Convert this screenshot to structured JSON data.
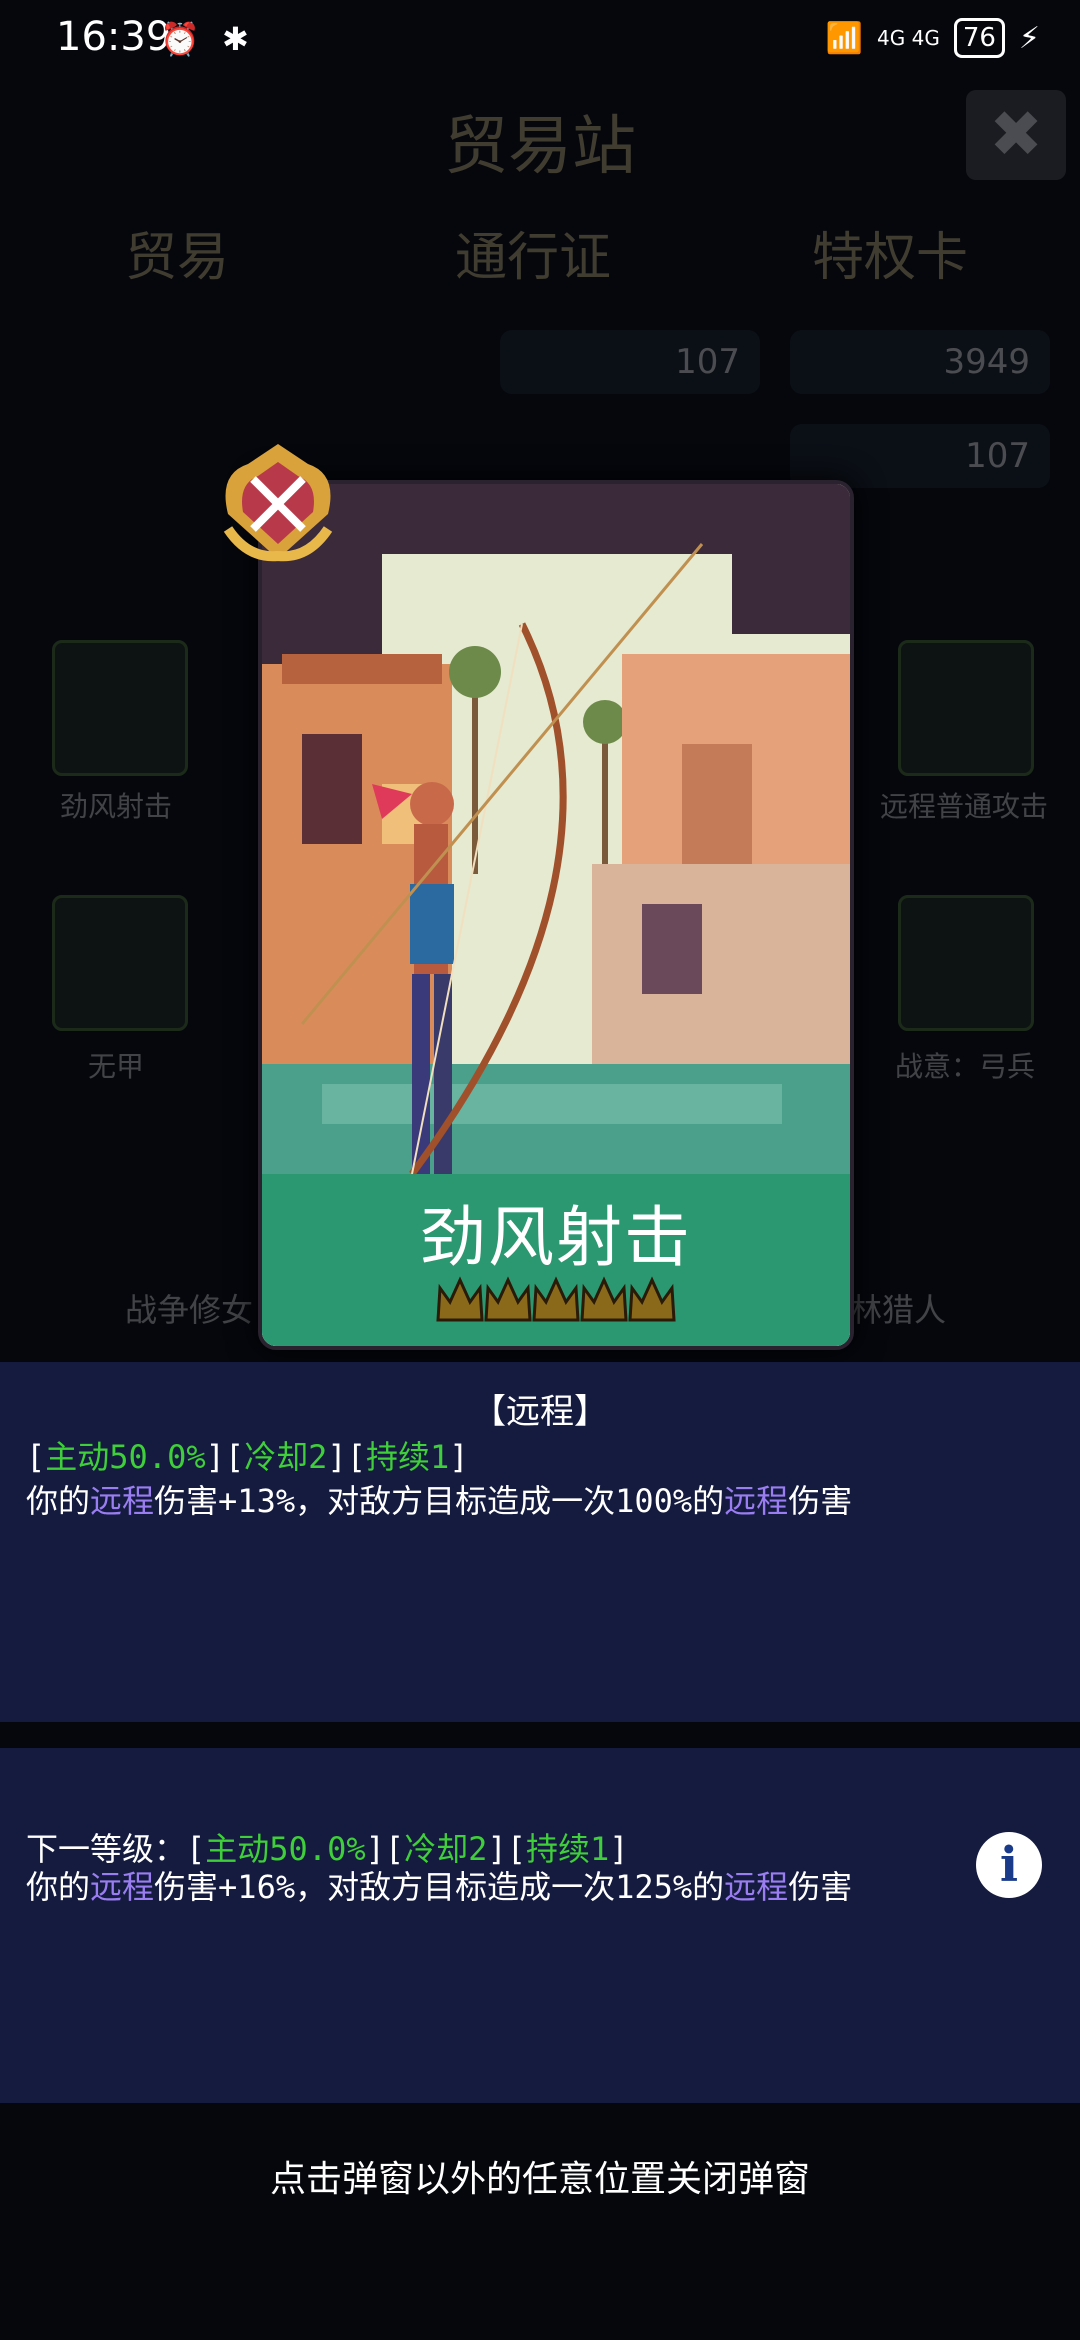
{
  "status_bar": {
    "time": "16:39",
    "left_icons": "⏰ ✱",
    "network": "4G 4G",
    "battery": "76"
  },
  "background": {
    "title": "贸易站",
    "tabs": [
      "贸易",
      "通行证",
      "特权卡"
    ],
    "currency": [
      {
        "value": "107"
      },
      {
        "value": "3949"
      },
      {
        "value": "107"
      }
    ],
    "items_left": [
      "劲风射击",
      "无甲",
      "战争修女"
    ],
    "items_right": [
      "远程普通攻击",
      "战意：弓兵",
      "林猎人"
    ]
  },
  "card": {
    "name": "劲风射击",
    "stars": 5
  },
  "skill": {
    "type": "【远程】",
    "current": {
      "open": "[",
      "active": "主动50.0%",
      "mid1": "][",
      "cooldown": "冷却2",
      "mid2": "][",
      "duration": "持续1",
      "close": "]",
      "d1": "你的",
      "kw1": "远程",
      "d2": "伤害+13%，对敌方目标造成一次100%的",
      "kw2": "远程",
      "d3": "伤害"
    },
    "next": {
      "label": "下一等级：[",
      "active": "主动50.0%",
      "mid1": "][",
      "cooldown": "冷却2",
      "mid2": "][",
      "duration": "持续1",
      "close": "]",
      "d1": "你的",
      "kw1": "远程",
      "d2": "伤害+16%，对敌方目标造成一次125%的",
      "kw2": "远程",
      "d3": "伤害"
    }
  },
  "hint": "点击弹窗以外的任意位置关闭弹窗",
  "colors": {
    "panel": "#141b3f",
    "green": "#3fcf3a",
    "purple": "#9a7df0",
    "card_band": "#289670"
  }
}
